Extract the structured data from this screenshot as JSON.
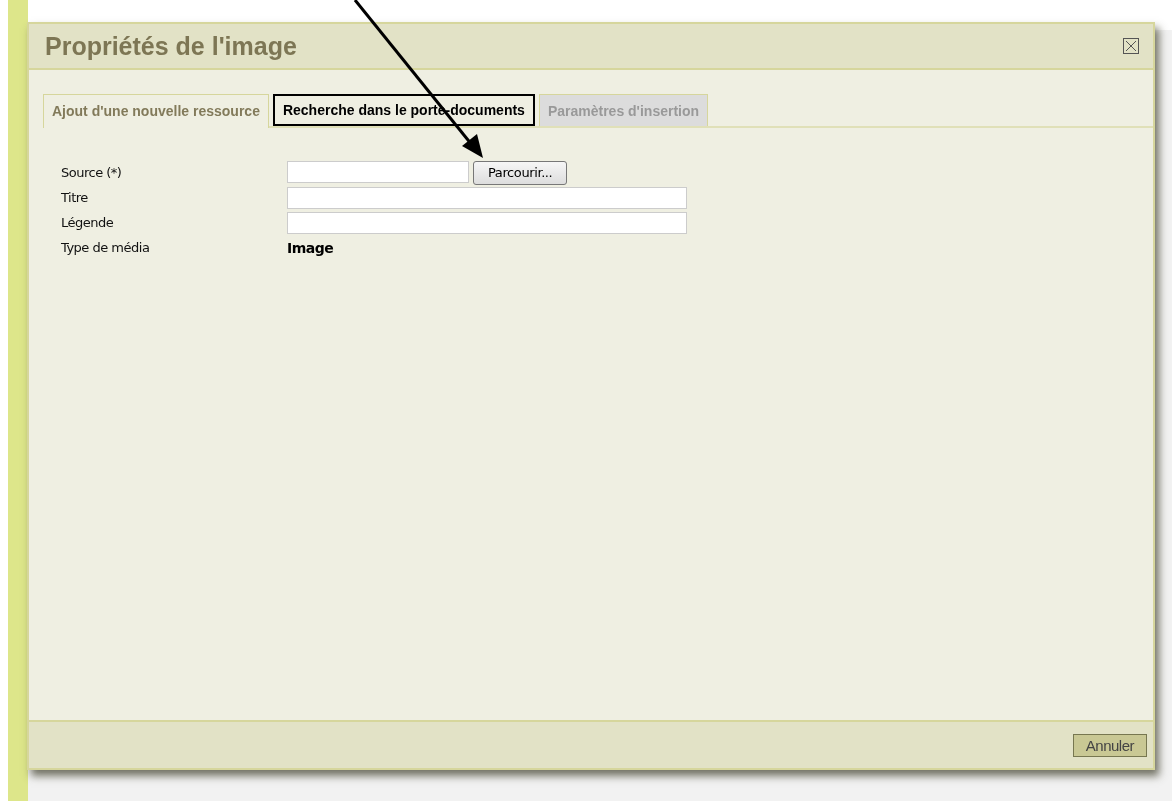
{
  "dialog": {
    "title": "Propriétés de l'image",
    "tabs": [
      {
        "label": "Ajout d'une nouvelle ressource",
        "selected": true,
        "outlined": false,
        "disabled": false
      },
      {
        "label": "Recherche dans le porte-documents",
        "selected": false,
        "outlined": true,
        "disabled": false
      },
      {
        "label": "Paramètres d'insertion",
        "selected": false,
        "outlined": false,
        "disabled": true
      }
    ],
    "form": [
      {
        "kind": "file",
        "label": "Source (*)",
        "button": "Parcourir..."
      },
      {
        "kind": "text",
        "label": "Titre"
      },
      {
        "kind": "text",
        "label": "Légende"
      },
      {
        "kind": "static",
        "label": "Type de média",
        "value": "Image"
      }
    ],
    "buttons": [
      "Annuler"
    ]
  }
}
